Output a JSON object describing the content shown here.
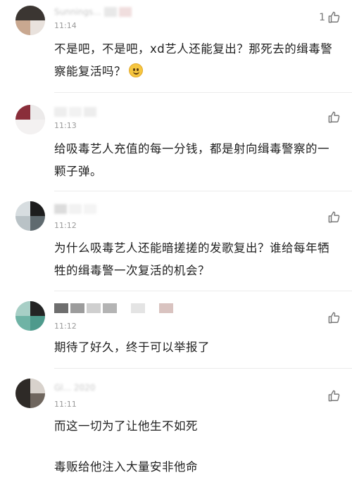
{
  "comments": [
    {
      "username": "Sunnings...",
      "time": "11:14",
      "likes": "1",
      "text": "不是吧，不是吧，xd艺人还能复出？那死去的缉毒警察能复活吗？",
      "emoji": "smiling-face"
    },
    {
      "username": "",
      "time": "11:13",
      "likes": "",
      "text": "给吸毒艺人充值的每一分钱，都是射向缉毒警察的一颗子弹。"
    },
    {
      "username": "",
      "time": "11:12",
      "likes": "",
      "text": "为什么吸毒艺人还能暗搓搓的发歌复出？谁给每年牺牲的缉毒警一次复活的机会？"
    },
    {
      "username": "",
      "time": "11:12",
      "likes": "",
      "text": "期待了好久，终于可以举报了"
    },
    {
      "username": "Gl... 2020",
      "time": "11:11",
      "likes": "",
      "text": "而这一切为了让他生不如死",
      "text2": "毒贩给他注入大量安非他命"
    }
  ],
  "colors": {
    "text": "#1f1f1f",
    "time": "#9a9a9a",
    "icon": "#777777",
    "separator": "#ebebeb"
  },
  "icons": {
    "like": "thumbs-up-icon"
  }
}
